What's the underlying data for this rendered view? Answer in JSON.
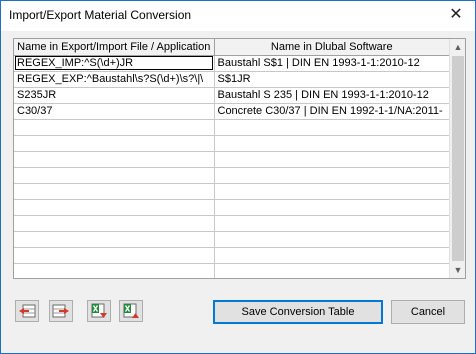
{
  "window": {
    "title": "Import/Export Material Conversion",
    "close_glyph": "✕"
  },
  "grid": {
    "columns": [
      "Name in Export/Import File / Application",
      "Name in Dlubal Software"
    ],
    "rows": [
      [
        "REGEX_IMP:^S(\\d+)JR",
        "Baustahl S$1 | DIN EN 1993-1-1:2010-12"
      ],
      [
        "REGEX_EXP:^Baustahl\\s?S(\\d+)\\s?\\|\\",
        "S$1JR"
      ],
      [
        "S235JR",
        "Baustahl S 235 | DIN EN 1993-1-1:2010-12"
      ],
      [
        "C30/37",
        "Concrete C30/37 | DIN EN 1992-1-1/NA:2011-"
      ],
      [
        "",
        ""
      ],
      [
        "",
        ""
      ],
      [
        "",
        ""
      ],
      [
        "",
        ""
      ],
      [
        "",
        ""
      ],
      [
        "",
        ""
      ],
      [
        "",
        ""
      ],
      [
        "",
        ""
      ],
      [
        "",
        ""
      ],
      [
        "",
        ""
      ]
    ]
  },
  "scrollbar": {
    "up": "▲",
    "down": "▼"
  },
  "toolbar": {
    "icons": [
      "insert-row-icon",
      "delete-row-icon",
      "import-excel-icon",
      "export-excel-icon"
    ]
  },
  "buttons": {
    "save": "Save Conversion Table",
    "cancel": "Cancel"
  },
  "colors": {
    "accent": "#0078d7",
    "window_border": "#1f6fc8",
    "icon_red": "#d23a2a",
    "icon_green": "#1e8a3a"
  }
}
